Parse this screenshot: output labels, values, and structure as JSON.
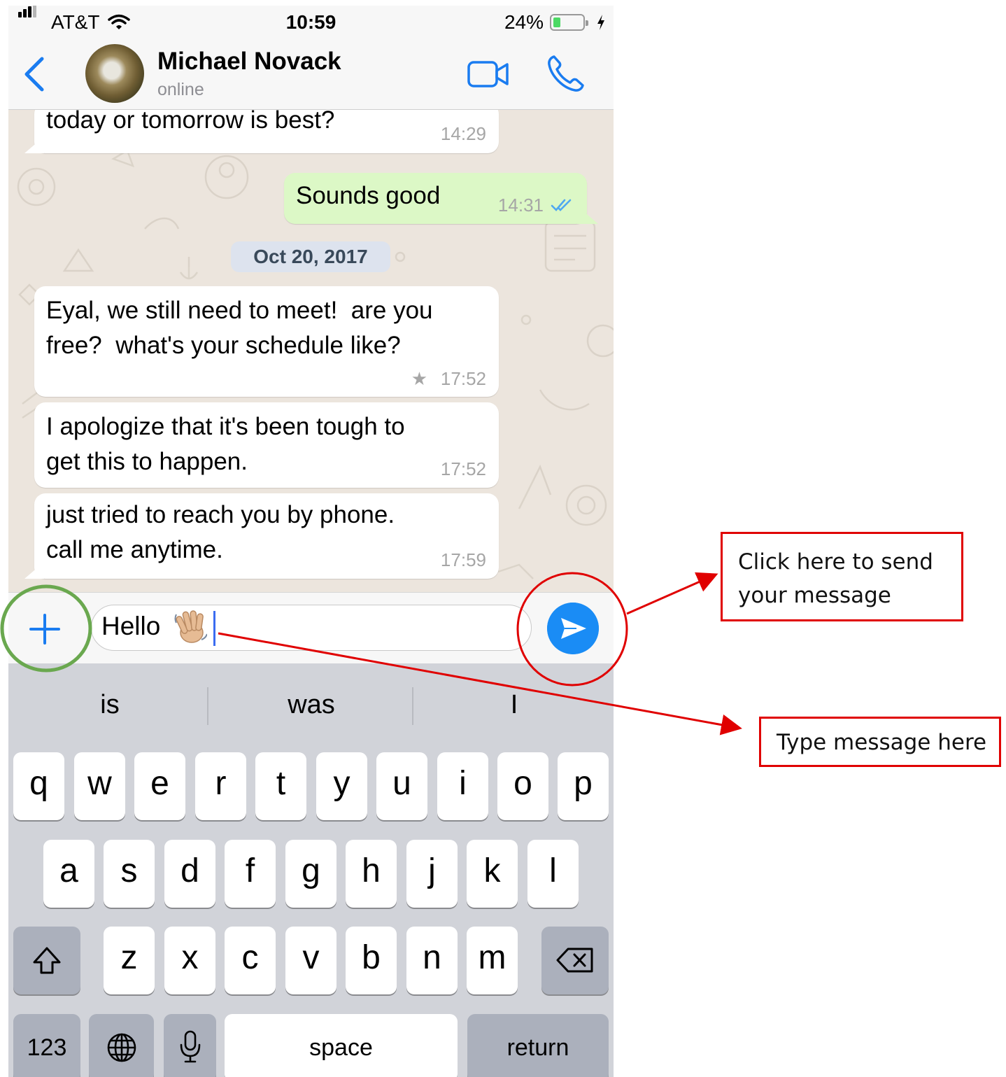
{
  "status_bar": {
    "carrier": "AT&T",
    "time": "10:59",
    "battery": "24%"
  },
  "header": {
    "contact_name": "Michael Novack",
    "contact_status": "online",
    "icons": [
      "back-icon",
      "video-call-icon",
      "phone-call-icon"
    ]
  },
  "messages": [
    {
      "direction": "incoming",
      "text": "today or tomorrow is best?",
      "time": "14:29"
    },
    {
      "direction": "outgoing",
      "text": "Sounds good",
      "time": "14:31",
      "read_receipt": "double-check"
    },
    {
      "direction": "incoming",
      "text": "Eyal, we still need to meet!  are you\nfree?  what's your schedule like?",
      "time": "17:52",
      "starred": true,
      "star": "★"
    },
    {
      "direction": "incoming",
      "text": "I apologize that it's been tough to\nget this to happen.",
      "time": "17:52"
    },
    {
      "direction": "incoming",
      "text": "just tried to reach you by phone.\ncall me anytime.",
      "time": "17:59"
    }
  ],
  "date_separator": "Oct 20, 2017",
  "composer": {
    "text": "Hello",
    "emoji": "👋🏼"
  },
  "keyboard": {
    "suggestions": [
      "is",
      "was",
      "I"
    ],
    "row1": [
      "q",
      "w",
      "e",
      "r",
      "t",
      "y",
      "u",
      "i",
      "o",
      "p"
    ],
    "row2": [
      "a",
      "s",
      "d",
      "f",
      "g",
      "h",
      "j",
      "k",
      "l"
    ],
    "row3": [
      "z",
      "x",
      "c",
      "v",
      "b",
      "n",
      "m"
    ],
    "numbers_key": "123",
    "space_key": "space",
    "return_key": "return"
  },
  "annotations": {
    "send_line1": "Click here to send",
    "send_line2": "your message",
    "type": "Type message here"
  },
  "colors": {
    "accent": "#1a8cf5",
    "outgoing_bubble": "#dcf8c6",
    "annotation_red": "#e00000",
    "highlight_green": "#6aa84f"
  }
}
